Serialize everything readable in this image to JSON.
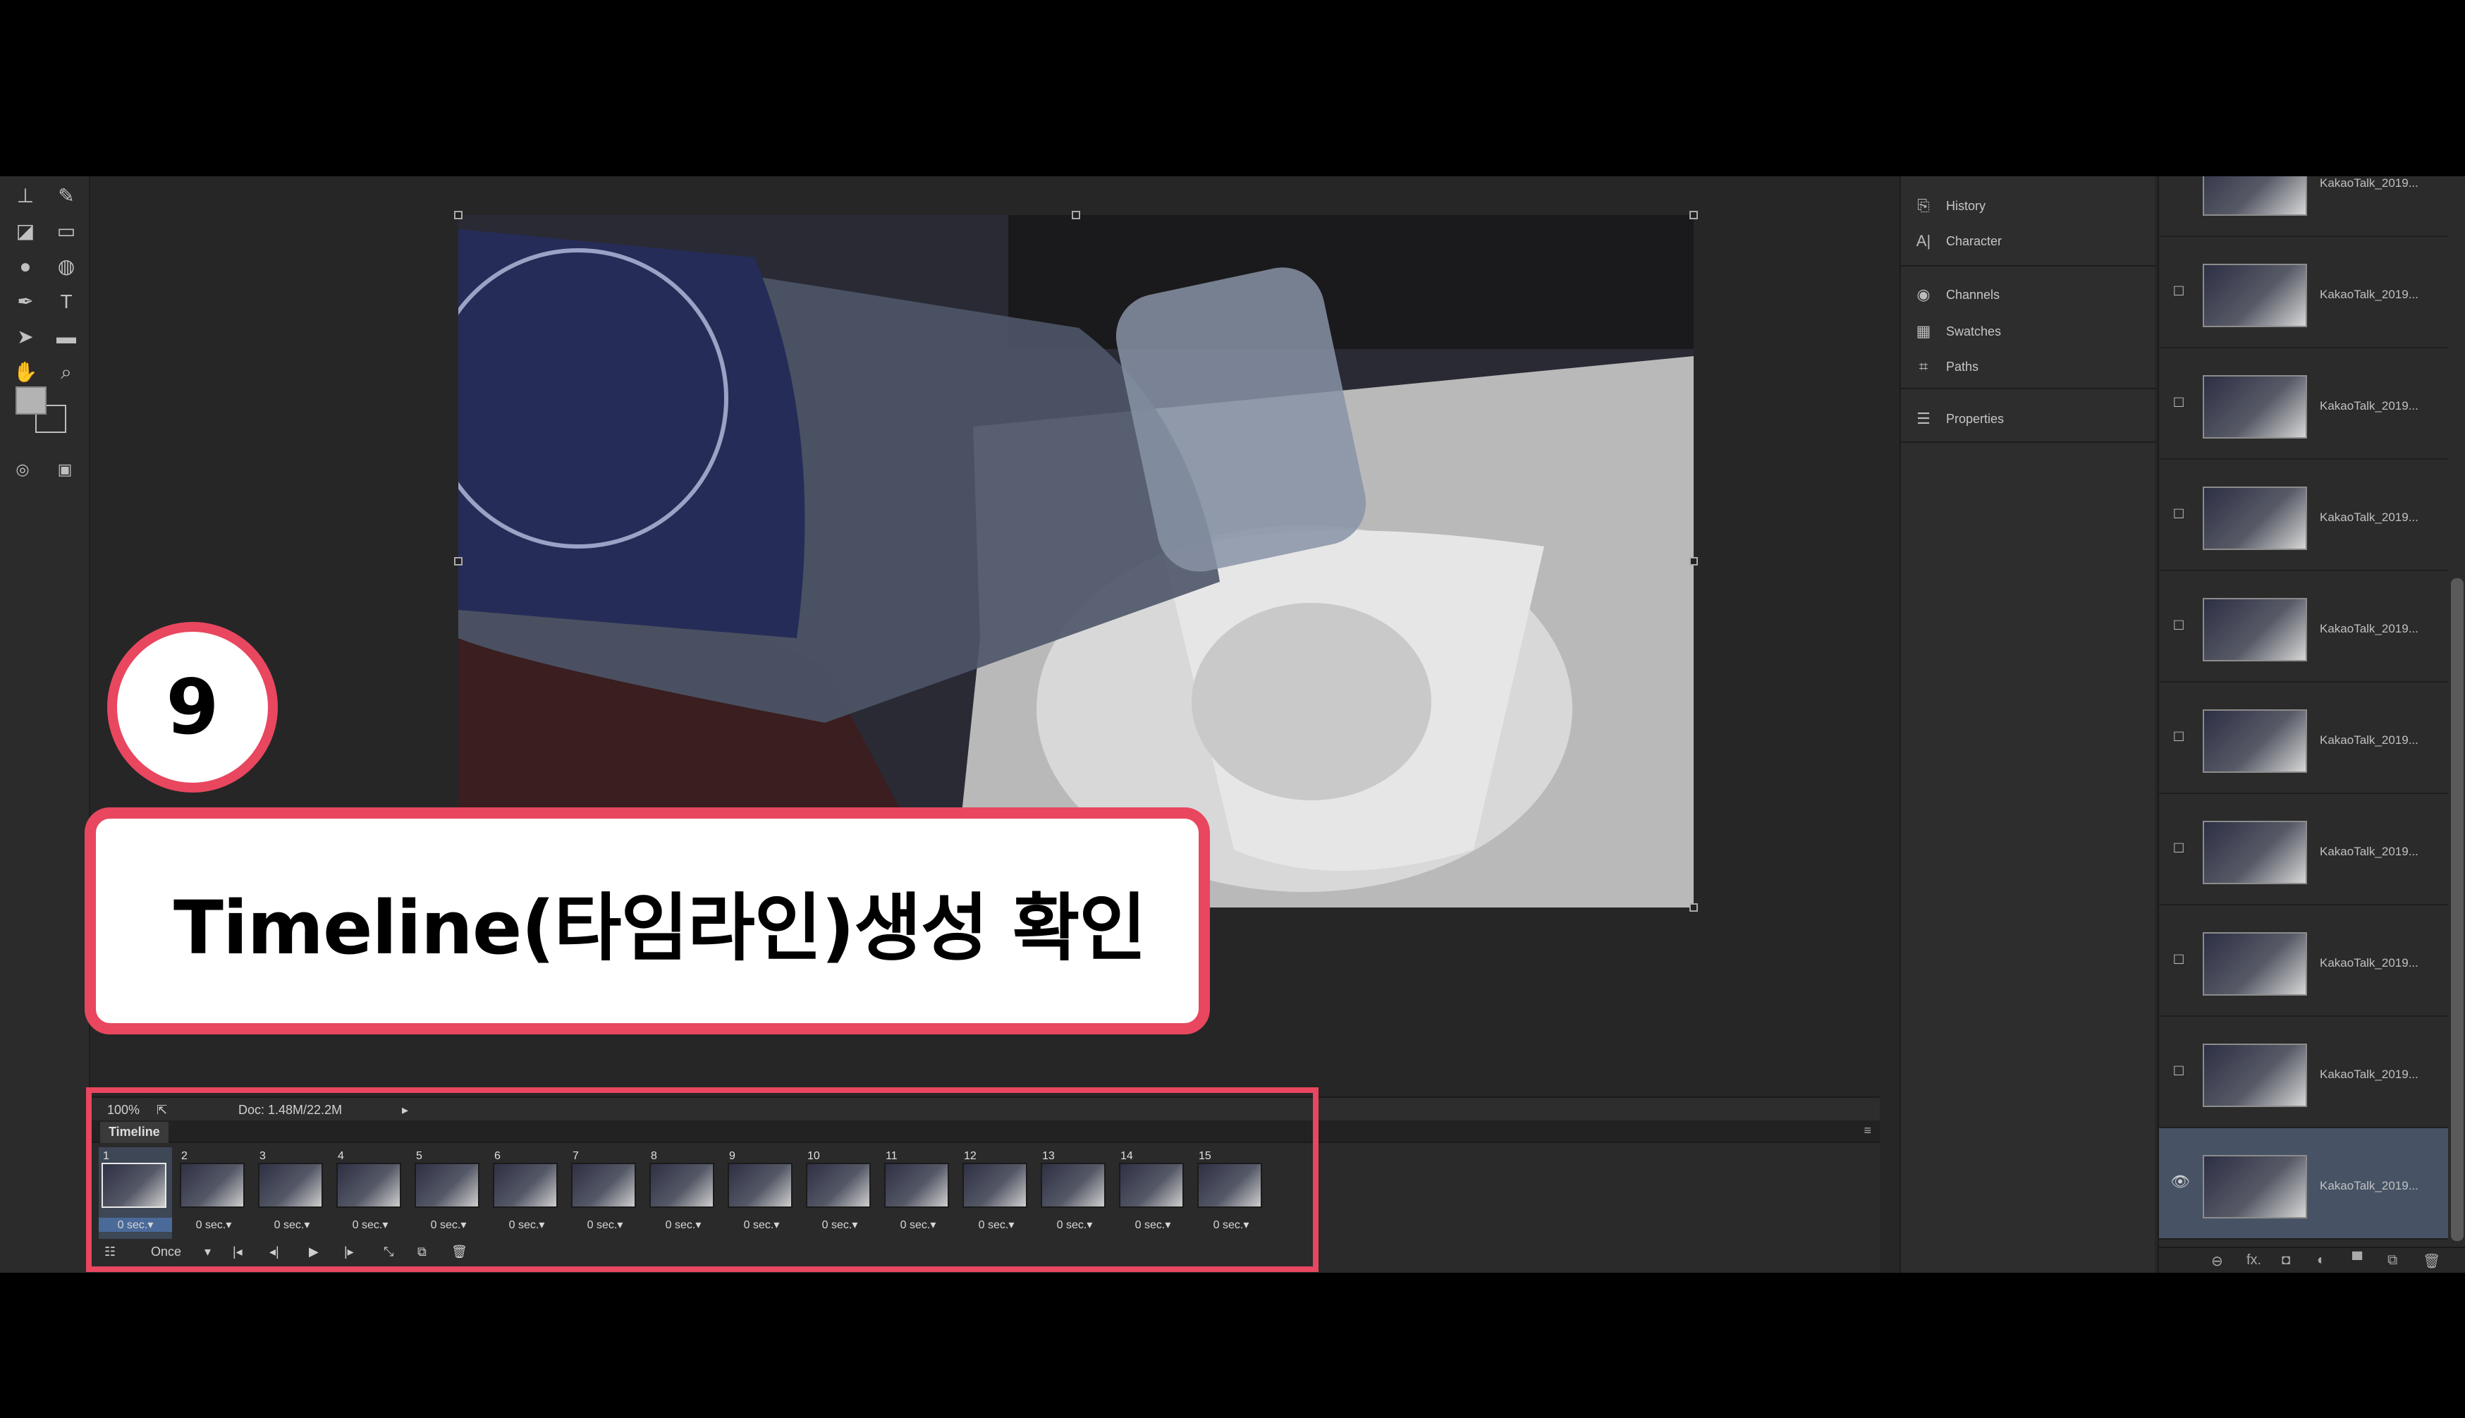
{
  "annotation": {
    "step_number": "9",
    "caption": "Timeline(타임라인)생성 확인",
    "accent_color": "#e8475f"
  },
  "toolbar": {
    "tools": [
      "stamp-tool-icon",
      "history-brush-icon",
      "eraser-icon",
      "gradient-icon",
      "blur-icon",
      "dodge-icon",
      "pen-icon",
      "type-icon",
      "path-select-icon",
      "rectangle-icon",
      "hand-icon",
      "zoom-icon",
      "quick-mask-icon",
      "screen-mode-icon"
    ],
    "type_glyph": "T"
  },
  "status_bar": {
    "zoom": "100%",
    "doc": "Doc: 1.48M/22.2M"
  },
  "timeline": {
    "title": "Timeline",
    "frames": [
      {
        "num": "1",
        "delay": "0 sec.▾"
      },
      {
        "num": "2",
        "delay": "0 sec.▾"
      },
      {
        "num": "3",
        "delay": "0 sec.▾"
      },
      {
        "num": "4",
        "delay": "0 sec.▾"
      },
      {
        "num": "5",
        "delay": "0 sec.▾"
      },
      {
        "num": "6",
        "delay": "0 sec.▾"
      },
      {
        "num": "7",
        "delay": "0 sec.▾"
      },
      {
        "num": "8",
        "delay": "0 sec.▾"
      },
      {
        "num": "9",
        "delay": "0 sec.▾"
      },
      {
        "num": "10",
        "delay": "0 sec.▾"
      },
      {
        "num": "11",
        "delay": "0 sec.▾"
      },
      {
        "num": "12",
        "delay": "0 sec.▾"
      },
      {
        "num": "13",
        "delay": "0 sec.▾"
      },
      {
        "num": "14",
        "delay": "0 sec.▾"
      },
      {
        "num": "15",
        "delay": "0 sec.▾"
      }
    ],
    "loop": "Once",
    "selected_frame": "1"
  },
  "panels": {
    "items": [
      {
        "label": "History",
        "icon": "history-icon"
      },
      {
        "label": "Character",
        "icon": "character-icon"
      },
      {
        "label": "Channels",
        "icon": "channels-icon"
      },
      {
        "label": "Swatches",
        "icon": "swatches-icon"
      },
      {
        "label": "Paths",
        "icon": "paths-icon"
      },
      {
        "label": "Properties",
        "icon": "properties-icon"
      }
    ]
  },
  "layers": {
    "items": [
      {
        "name": "KakaoTalk_2019..."
      },
      {
        "name": "KakaoTalk_2019..."
      },
      {
        "name": "KakaoTalk_2019..."
      },
      {
        "name": "KakaoTalk_2019..."
      },
      {
        "name": "KakaoTalk_2019..."
      },
      {
        "name": "KakaoTalk_2019..."
      },
      {
        "name": "KakaoTalk_2019..."
      },
      {
        "name": "KakaoTalk_2019..."
      },
      {
        "name": "KakaoTalk_2019..."
      },
      {
        "name": "KakaoTalk_2019..."
      }
    ],
    "footer_fx": "fx."
  }
}
